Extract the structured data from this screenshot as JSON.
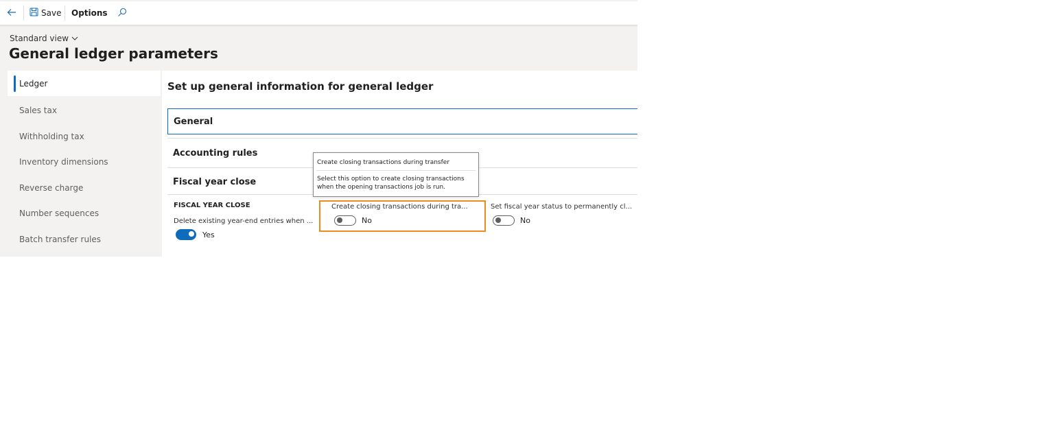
{
  "toolbar": {
    "back_icon": "back-arrow-icon",
    "save_icon": "save-disk-icon",
    "save_label": "Save",
    "options_label": "Options",
    "search_icon": "search-icon"
  },
  "header": {
    "view_selector": "Standard view",
    "page_title": "General ledger parameters"
  },
  "nav": {
    "items": [
      {
        "label": "Ledger",
        "active": true
      },
      {
        "label": "Sales tax"
      },
      {
        "label": "Withholding tax"
      },
      {
        "label": "Inventory dimensions"
      },
      {
        "label": "Reverse charge"
      },
      {
        "label": "Number sequences"
      },
      {
        "label": "Batch transfer rules"
      }
    ]
  },
  "main": {
    "title": "Set up general information for general ledger",
    "sections": [
      {
        "label": "General",
        "focused": true
      },
      {
        "label": "Accounting rules"
      },
      {
        "label": "Fiscal year close",
        "expanded": true
      }
    ],
    "fiscal_year_close": {
      "group_heading": "FISCAL YEAR CLOSE",
      "fields": [
        {
          "label": "Delete existing year-end entries when ...",
          "value": "Yes",
          "on": true
        },
        {
          "label": "Create closing transactions during tra...",
          "value": "No",
          "on": false
        },
        {
          "label": "Set fiscal year status to permanently cl...",
          "value": "No",
          "on": false
        }
      ]
    }
  },
  "tooltip": {
    "title": "Create closing transactions during transfer",
    "body": "Select this option to create closing transactions when the opening transactions job is run."
  },
  "colors": {
    "accent": "#0f6cbd",
    "highlight": "#f08a1c"
  }
}
